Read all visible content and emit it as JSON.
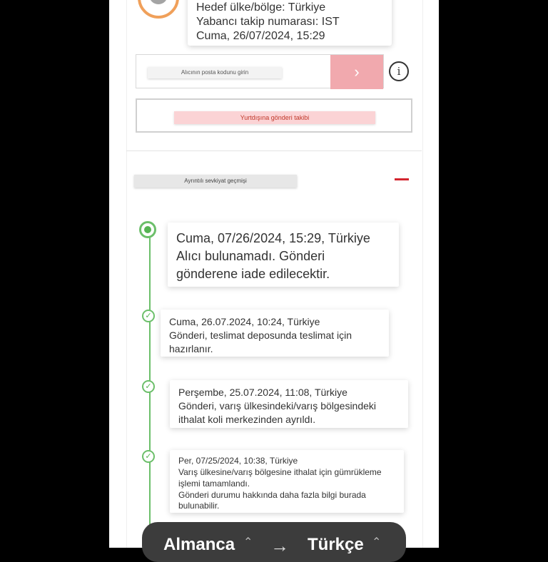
{
  "shipment": {
    "destination": "Hedef ülke/bölge: Türkiye",
    "foreign_tracking": "Yabancı takip numarası: IST",
    "date": "Cuma, 26/07/2024, 15:29"
  },
  "postal": {
    "placeholder": "Alıcının posta kodunu girin",
    "submit_glyph": "›"
  },
  "info_glyph": "i",
  "foreign_button": "Yurtdışına gönderi takibi",
  "history": {
    "title": "Ayrıntılı sevkiyat geçmişi",
    "events": [
      {
        "line1": "Cuma, 07/26/2024, 15:29, Türkiye",
        "line2": "Alıcı bulunamadı. Gönderi",
        "line3": "gönderene iade edilecektir."
      },
      {
        "line1": "Cuma, 26.07.2024, 10:24, Türkiye",
        "line2": "Gönderi, teslimat deposunda teslimat için",
        "line3": "hazırlanır."
      },
      {
        "line1": "Perşembe, 25.07.2024, 11:08, Türkiye",
        "line2": "Gönderi, varış ülkesindeki/varış bölgesindeki",
        "line3": "ithalat koli merkezinden ayrıldı."
      },
      {
        "line1": "Per, 07/25/2024, 10:38, Türkiye",
        "line2": "Varış ülkesine/varış bölgesine ithalat için gümrükleme",
        "line3": "işlemi tamamlandı.",
        "line4": "Gönderi durumu hakkında daha fazla bilgi burada",
        "line5": "bulunabilir."
      }
    ]
  },
  "translate": {
    "source": "Almanca",
    "target": "Türkçe",
    "arrow": "→",
    "caret": "⌃"
  },
  "colors": {
    "accent_red": "#d3252f",
    "timeline_green": "#6cbf6a",
    "orange_ring": "#f0a05a"
  }
}
